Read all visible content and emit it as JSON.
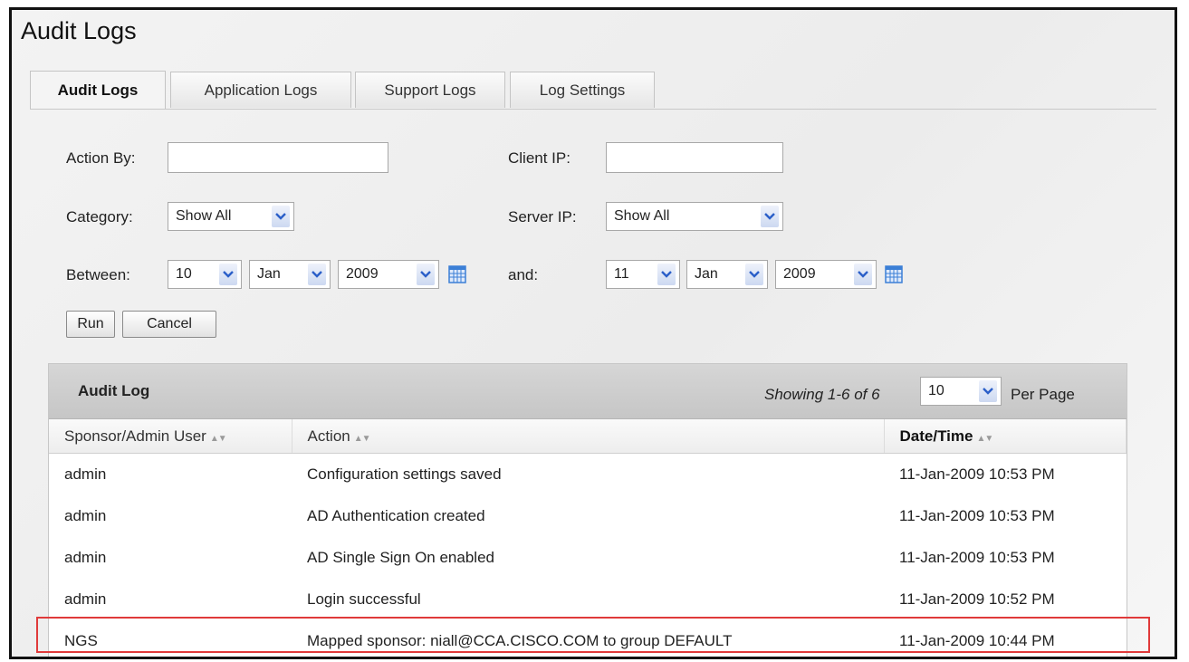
{
  "page_title": "Audit Logs",
  "tabs": [
    {
      "label": "Audit Logs",
      "active": true
    },
    {
      "label": "Application Logs",
      "active": false
    },
    {
      "label": "Support Logs",
      "active": false
    },
    {
      "label": "Log Settings",
      "active": false
    }
  ],
  "filters": {
    "action_by": {
      "label": "Action By:",
      "value": ""
    },
    "client_ip": {
      "label": "Client IP:",
      "value": ""
    },
    "category": {
      "label": "Category:",
      "value": "Show All"
    },
    "server_ip": {
      "label": "Server IP:",
      "value": "Show All"
    },
    "between": {
      "label": "Between:",
      "day": "10",
      "month": "Jan",
      "year": "2009"
    },
    "and": {
      "label": "and:",
      "day": "11",
      "month": "Jan",
      "year": "2009"
    }
  },
  "buttons": {
    "run": "Run",
    "cancel": "Cancel"
  },
  "panel": {
    "title": "Audit Log",
    "showing": "Showing 1-6 of 6",
    "per_page_value": "10",
    "per_page_label": "Per Page",
    "columns": [
      "Sponsor/Admin User",
      "Action",
      "Date/Time"
    ],
    "rows": [
      {
        "user": "admin",
        "action": "Configuration settings saved",
        "datetime": "11-Jan-2009 10:53 PM"
      },
      {
        "user": "admin",
        "action": "AD Authentication created",
        "datetime": "11-Jan-2009 10:53 PM"
      },
      {
        "user": "admin",
        "action": "AD Single Sign On enabled",
        "datetime": "11-Jan-2009 10:53 PM"
      },
      {
        "user": "admin",
        "action": "Login successful",
        "datetime": "11-Jan-2009 10:52 PM"
      },
      {
        "user": "NGS",
        "action": "Mapped sponsor: niall@CCA.CISCO.COM to group DEFAULT",
        "datetime": "11-Jan-2009 10:44 PM"
      }
    ]
  },
  "colors": {
    "highlight": "#e03a3a",
    "select_arrow": "#2b5fc9",
    "calendar": "#3b7fd6"
  }
}
